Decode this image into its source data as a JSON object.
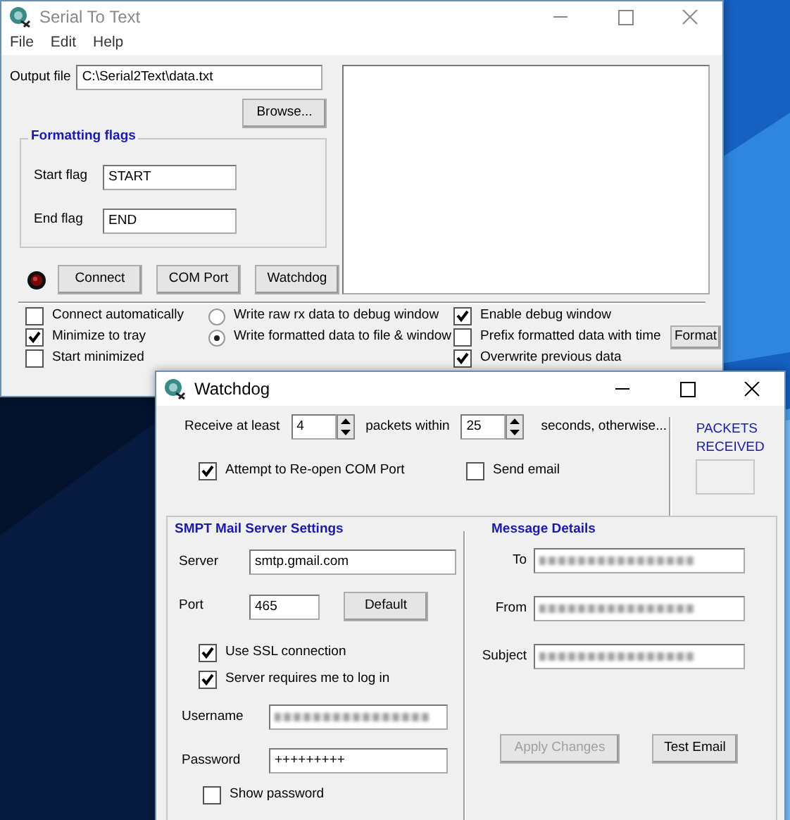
{
  "main_window": {
    "title": "Serial To Text",
    "menu": [
      "File",
      "Edit",
      "Help"
    ],
    "output_file": {
      "label": "Output file",
      "value": "C:\\Serial2Text\\data.txt"
    },
    "browse_button": "Browse...",
    "formatting_flags": {
      "title": "Formatting flags",
      "fields": [
        {
          "label": "Start flag",
          "value": "START"
        },
        {
          "label": "End flag",
          "value": "END"
        }
      ]
    },
    "connection_led": {
      "on": false
    },
    "buttons": [
      "Connect",
      "COM Port",
      "Watchdog"
    ],
    "option_columns": [
      [
        {
          "kind": "checkbox",
          "label": "Connect automatically",
          "checked": false
        },
        {
          "kind": "checkbox",
          "label": "Minimize to tray",
          "checked": true
        },
        {
          "kind": "checkbox",
          "label": "Start minimized",
          "checked": false
        }
      ],
      [
        {
          "kind": "radio",
          "label": "Write raw rx data to debug window",
          "selected": false
        },
        {
          "kind": "radio",
          "label": "Write formatted data to file & window",
          "selected": true
        }
      ],
      [
        {
          "kind": "checkbox",
          "label": "Enable debug window",
          "checked": true
        },
        {
          "kind": "checkbox",
          "label": "Prefix formatted data with time",
          "checked": false
        },
        {
          "kind": "checkbox",
          "label": "Overwrite previous data",
          "checked": true
        }
      ]
    ],
    "format_button": "Format"
  },
  "watchdog_window": {
    "title": "Watchdog",
    "receive_row": {
      "prefix": "Receive at least",
      "packets": "4",
      "middle": "packets within",
      "seconds": "25",
      "suffix": "seconds, otherwise..."
    },
    "packets_received": {
      "label": "PACKETS RECEIVED"
    },
    "actions": [
      {
        "label": "Attempt to Re-open COM Port",
        "checked": true
      },
      {
        "label": "Send email",
        "checked": false
      }
    ],
    "smtp": {
      "title": "SMPT Mail Server Settings",
      "server": {
        "label": "Server",
        "value": "smtp.gmail.com"
      },
      "port": {
        "label": "Port",
        "value": "465"
      },
      "default_button": "Default",
      "options": [
        {
          "label": "Use SSL connection",
          "checked": true
        },
        {
          "label": "Server requires me to log in",
          "checked": true
        }
      ],
      "username": {
        "label": "Username",
        "obscured": true
      },
      "password": {
        "label": "Password",
        "value": "+++++++++"
      },
      "show_password": {
        "label": "Show password",
        "checked": false
      }
    },
    "message": {
      "title": "Message Details",
      "fields": [
        {
          "label": "To",
          "obscured": true
        },
        {
          "label": "From",
          "obscured": true
        },
        {
          "label": "Subject",
          "obscured": true
        }
      ],
      "buttons": [
        {
          "label": "Apply Changes",
          "disabled": true
        },
        {
          "label": "Test Email",
          "disabled": false
        }
      ]
    }
  }
}
